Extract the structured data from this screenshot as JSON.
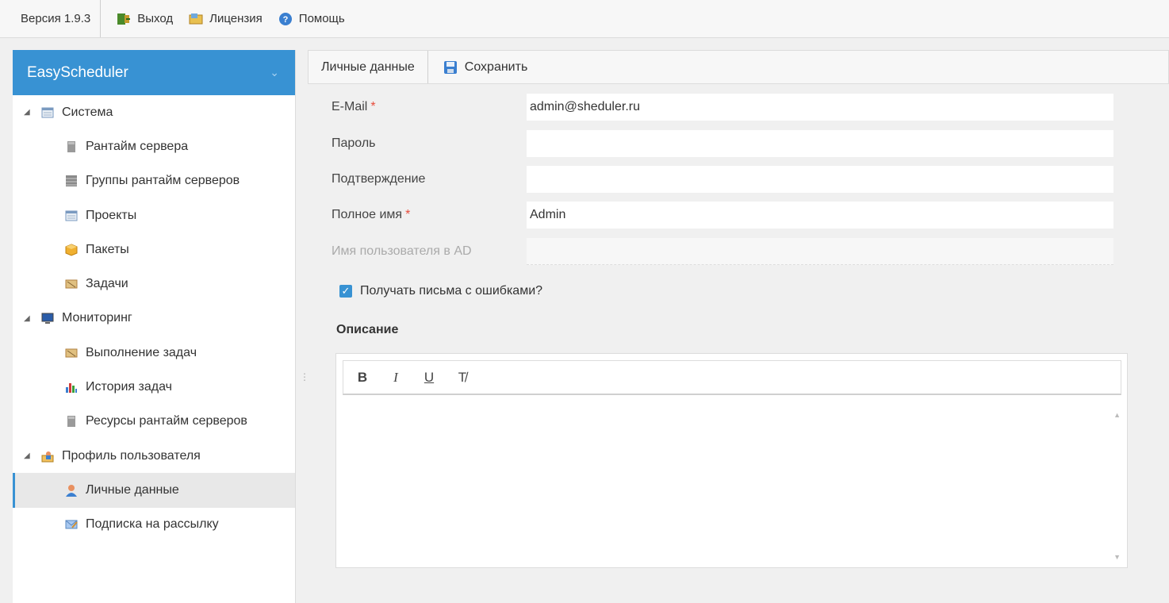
{
  "topbar": {
    "version": "Версия 1.9.3",
    "exit": "Выход",
    "license": "Лицензия",
    "help": "Помощь"
  },
  "sidebar": {
    "title": "EasyScheduler",
    "groups": [
      {
        "label": "Система",
        "icon": "table-icon",
        "items": [
          {
            "label": "Рантайм сервера",
            "icon": "server-icon"
          },
          {
            "label": "Группы рантайм серверов",
            "icon": "server-group-icon"
          },
          {
            "label": "Проекты",
            "icon": "table-icon"
          },
          {
            "label": "Пакеты",
            "icon": "package-icon"
          },
          {
            "label": "Задачи",
            "icon": "task-icon"
          }
        ]
      },
      {
        "label": "Мониторинг",
        "icon": "monitor-icon",
        "items": [
          {
            "label": "Выполнение задач",
            "icon": "task-icon"
          },
          {
            "label": "История задач",
            "icon": "chart-icon"
          },
          {
            "label": "Ресурсы рантайм серверов",
            "icon": "server-icon"
          }
        ]
      },
      {
        "label": "Профиль пользователя",
        "icon": "user-profile-icon",
        "items": [
          {
            "label": "Личные данные",
            "icon": "user-icon",
            "selected": true
          },
          {
            "label": "Подписка на рассылку",
            "icon": "mail-icon"
          }
        ]
      }
    ]
  },
  "toolbar": {
    "title": "Личные данные",
    "save": "Сохранить"
  },
  "form": {
    "email": {
      "label": "E-Mail",
      "required": "*",
      "value": "admin@sheduler.ru"
    },
    "password": {
      "label": "Пароль",
      "value": ""
    },
    "confirm": {
      "label": "Подтверждение",
      "value": ""
    },
    "fullname": {
      "label": "Полное имя",
      "required": "*",
      "value": "Admin"
    },
    "ad_user": {
      "label": "Имя пользователя в AD",
      "value": ""
    },
    "errors_checkbox": {
      "label": "Получать письма с ошибками?",
      "checked": true
    },
    "description_label": "Описание"
  },
  "editor": {
    "bold": "B",
    "italic": "I",
    "underline": "U",
    "clear": "T̸"
  },
  "colors": {
    "accent": "#3892d3",
    "required": "#e74c3c"
  }
}
